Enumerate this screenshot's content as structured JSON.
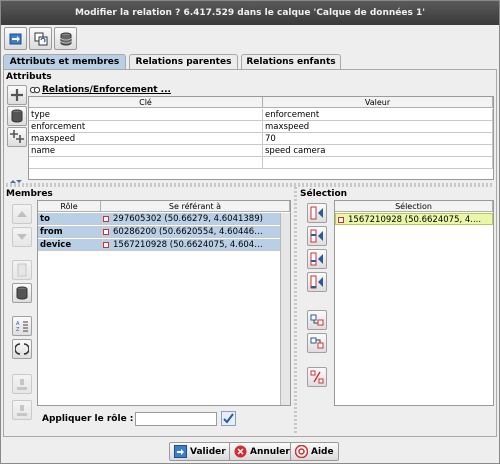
{
  "window": {
    "title": "Modifier la relation ? 6.417.529 dans le calque 'Calque de données 1'"
  },
  "toolbar": {
    "icons": [
      "apply-tags-icon",
      "refresh-icon",
      "database-icon"
    ]
  },
  "tabs": [
    {
      "label": "Attributs et membres",
      "active": true
    },
    {
      "label": "Relations parentes",
      "active": false
    },
    {
      "label": "Relations enfants",
      "active": false
    }
  ],
  "attributes": {
    "section_label": "Attributs",
    "preset_label": "Relations/Enforcement ...",
    "columns": [
      "Clé",
      "Valeur"
    ],
    "rows": [
      {
        "key": "type",
        "value": "enforcement"
      },
      {
        "key": "enforcement",
        "value": "maxspeed"
      },
      {
        "key": "maxspeed",
        "value": "70"
      },
      {
        "key": "name",
        "value": "speed camera"
      }
    ]
  },
  "members": {
    "section_label": "Membres",
    "columns": [
      "Rôle",
      "Se référant à"
    ],
    "rows": [
      {
        "role": "to",
        "ref": "297605302 (50.66279, 4.6041389)"
      },
      {
        "role": "from",
        "ref": "60286200 (50.6620554, 4.60446…"
      },
      {
        "role": "device",
        "ref": "1567210928 (50.6624075, 4.604…"
      }
    ],
    "apply_role_label": "Appliquer le rôle :",
    "apply_role_value": ""
  },
  "selection": {
    "section_label": "Sélection",
    "column": "Sélection",
    "rows": [
      {
        "ref": "1567210928 (50.6624075, 4...."
      }
    ]
  },
  "buttons": {
    "ok": "Valider",
    "cancel": "Annuler",
    "help": "Aide"
  },
  "colors": {
    "title_bg": "#454545",
    "selected_row": "#b8cfe5",
    "selection_highlight": "#eaf7a8",
    "node_icon": "#d03030"
  }
}
